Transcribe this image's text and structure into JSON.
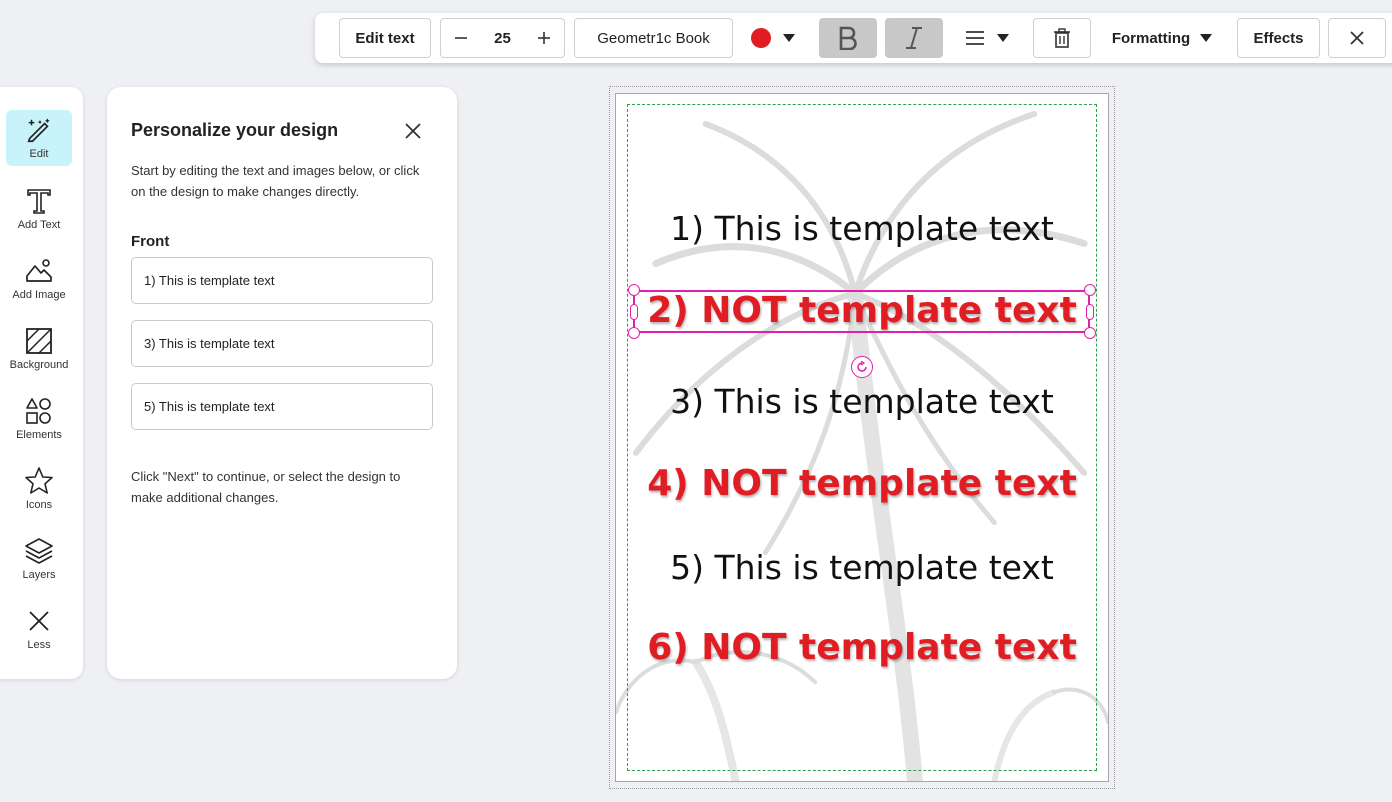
{
  "toolbar": {
    "edit_text": "Edit text",
    "font_size": "25",
    "font_name": "Geometr1c Book",
    "text_color": "#e11d24",
    "formatting": "Formatting",
    "effects": "Effects"
  },
  "rail": {
    "items": [
      {
        "label": "Edit",
        "icon": "magic-pencil-icon",
        "active": true
      },
      {
        "label": "Add Text",
        "icon": "text-t-icon"
      },
      {
        "label": "Add Image",
        "icon": "image-mountain-icon"
      },
      {
        "label": "Background",
        "icon": "background-hatch-icon"
      },
      {
        "label": "Elements",
        "icon": "shapes-icon"
      },
      {
        "label": "Icons",
        "icon": "star-icon"
      },
      {
        "label": "Layers",
        "icon": "layers-icon"
      },
      {
        "label": "Less",
        "icon": "close-icon"
      }
    ]
  },
  "panel": {
    "title": "Personalize your design",
    "description": "Start by editing the text and images below, or click on the design to make changes directly.",
    "section": "Front",
    "fields": [
      "1) This is template text",
      "3) This is template text",
      "5) This is template text"
    ],
    "footer": "Click \"Next\" to continue, or select the design to make additional changes."
  },
  "canvas": {
    "lines": [
      "1) This is template text",
      "2) NOT template text",
      "3) This is template text",
      "4) NOT template text",
      "5) This is template text",
      "6) NOT template text"
    ],
    "colors": {
      "black_text": "#111111",
      "red_text": "#e11d24",
      "selection": "#e020a8",
      "safe_zone": "#2e9f4d"
    }
  }
}
